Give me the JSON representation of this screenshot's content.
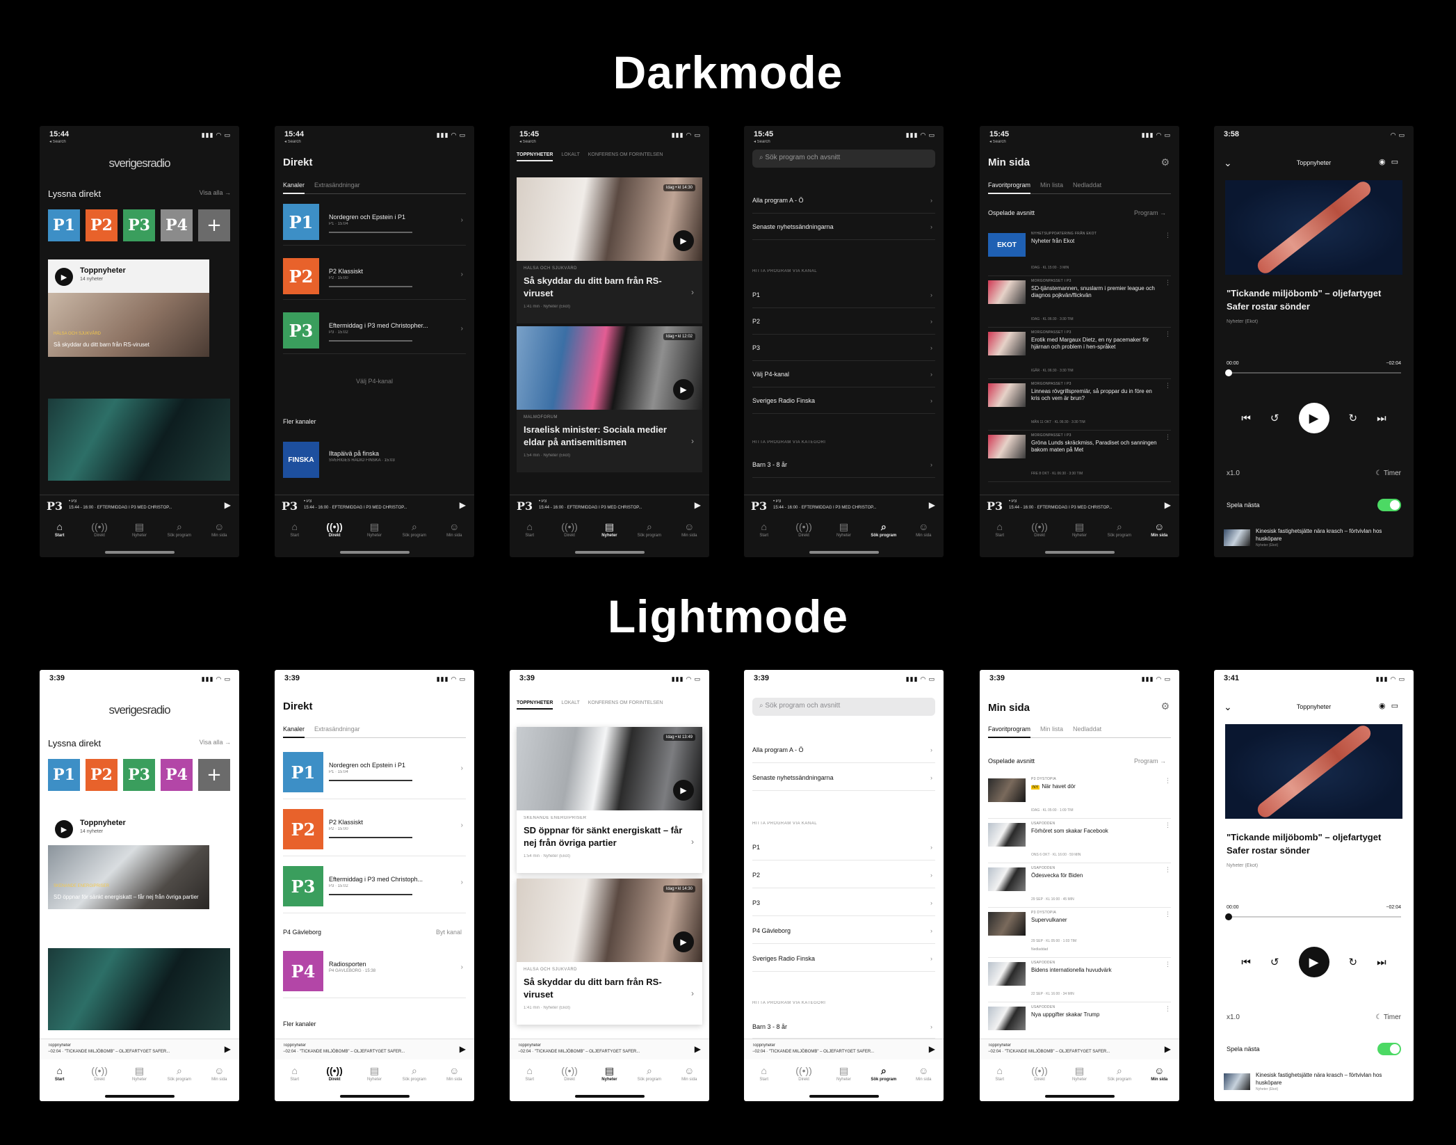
{
  "headings": {
    "dark": "Darkmode",
    "light": "Lightmode"
  },
  "status": {
    "dark_time_1": "15:44",
    "dark_time_2": "15:44",
    "dark_time_3": "15:45",
    "dark_time_4": "15:45",
    "dark_time_5": "15:45",
    "dark_time_6": "3:58",
    "light_time": "3:39",
    "light_time_6": "3:41",
    "back": "◂ Search"
  },
  "home": {
    "logo": "sverigesradio",
    "listen_title": "Lyssna direkt",
    "see_all": "Visa alla →",
    "channels": [
      "P1",
      "P2",
      "P3",
      "P4",
      "+"
    ],
    "card_title": "Toppnyheter",
    "card_sub": "14 nyheter",
    "dark_tag": "HÄLSA OCH SJUKVÅRD",
    "dark_caption": "Så skyddar du ditt barn från RS-viruset",
    "light_tag": "SKENANDE ENERGIPRISER",
    "light_caption": "SD öppnar för sänkt energiskatt – får nej från övriga partier"
  },
  "miniplayer": {
    "logo": "P3",
    "dark_line1": "• P3",
    "dark_line2": "15:44 - 16:00 · EFTERMIDDAG I P3 MED CHRISTOP...",
    "light_line1": "Toppnyheter",
    "light_line2": "−02:04 · \"TICKANDE MILJÖBOMB\" – OLJEFARTYGET SAFER..."
  },
  "tabs": [
    "Start",
    "Direkt",
    "Nyheter",
    "Sök program",
    "Min sida"
  ],
  "tab_icons": [
    "⌂",
    "((•))",
    "▤",
    "⌕",
    "☺"
  ],
  "direkt": {
    "title": "Direkt",
    "seg": [
      "Kanaler",
      "Extrasändningar"
    ],
    "rows": [
      {
        "name": "Nordegren och Epstein i P1",
        "meta": "P1 · 15:04"
      },
      {
        "name": "P2 Klassiskt",
        "meta": "P2 · 15:00"
      },
      {
        "name": "Eftermiddag i P3 med Christopher...",
        "meta": "P3 · 15:02"
      }
    ],
    "light_row3": "Eftermiddag i P3 med Christoph...",
    "choose_p4": "Välj P4-kanal",
    "more_channels": "Fler kanaler",
    "finska_tile": "FINSKA",
    "finska_name": "Iltapäivä på finska",
    "finska_meta": "SVERIGES RADIO FINSKA · 15:03",
    "p4_region": "P4 Gävleborg",
    "change_channel": "Byt kanal",
    "radiosporten": "Radiosporten",
    "radiosporten_meta": "P4 GÄVLEBORG · 15:38"
  },
  "nyheter": {
    "nav": [
      "TOPPNYHETER",
      "LOKALT",
      "KONFERENS OM FÖRINTELSEN"
    ],
    "badge1": "Idag • kl 14:30",
    "badge2": "Idag • kl 12:02",
    "badge3": "Idag • kl 13:49",
    "rs_tag": "HÄLSA OCH SJUKVÅRD",
    "rs_title": "Så skyddar du ditt barn från RS-viruset",
    "rs_meta": "1:41 min · Nyheter (Ekot)",
    "isr_tag": "MALMÖFORUM",
    "isr_title": "Israelisk minister: Sociala medier eldar på antisemitismen",
    "isr_meta": "1:54 min · Nyheter (Ekot)",
    "sd_tag": "SKENANDE ENERGIPRISER",
    "sd_title": "SD öppnar för sänkt energiskatt – får nej från övriga partier",
    "sd_meta": "1:54 min · Nyheter (Ekot)"
  },
  "sok": {
    "placeholder": "Sök program och avsnitt",
    "top": [
      "Alla program A - Ö",
      "Senaste nyhetssändningarna"
    ],
    "by_channel": "HITTA PROGRAM VIA KANAL",
    "channels_dark": [
      "P1",
      "P2",
      "P3",
      "Välj P4-kanal",
      "Sveriges Radio Finska"
    ],
    "channels_light": [
      "P1",
      "P2",
      "P3",
      "P4 Gävleborg",
      "Sveriges Radio Finska"
    ],
    "by_category": "HITTA PROGRAM VIA KATEGORI",
    "category_first": "Barn 3 - 8 år"
  },
  "minsida": {
    "title": "Min sida",
    "seg": [
      "Favoritprogram",
      "Min lista",
      "Nedladdat"
    ],
    "unplayed": "Ospelade avsnitt",
    "program_link": "Program →",
    "dark_eps": [
      {
        "tag": "NYHETSUPPDATERING FRÅN EKOT",
        "title": "Nyheter från Ekot",
        "meta": "IDAG · KL 15:00 · 3 MIN",
        "thumb": "EKOT"
      },
      {
        "tag": "MORGONPASSET I P3",
        "title": "SD-tjänstemannen, snuslarm i premier league och diagnos pojkvän/flickvän",
        "meta": "IDAG · KL 06:30 · 3:30 TIM",
        "thumb": ""
      },
      {
        "tag": "MORGONPASSET I P3",
        "title": "Erotik med Margaux Dietz, en ny pacemaker för hjärnan och problem i hen-språket",
        "meta": "IGÅR · KL 06:30 · 3:30 TIM",
        "thumb": ""
      },
      {
        "tag": "MORGONPASSET I P3",
        "title": "Linneas rövgrillspremiär, så proppar du in före en kris och vem är brun?",
        "meta": "MÅN 11 OKT · KL 06:30 · 3:30 TIM",
        "thumb": ""
      },
      {
        "tag": "MORGONPASSET I P3",
        "title": "Gröna Lunds skräckmiss, Paradiset och sanningen bakom maten på Met",
        "meta": "FRE 8 OKT · KL 06:30 · 3:30 TIM",
        "thumb": ""
      }
    ],
    "light_eps": [
      {
        "tag": "P3 DYSTOPIA",
        "title": "När havet dör",
        "meta": "IDAG · KL 05:00 · 1:09 TIM"
      },
      {
        "tag": "USAPODDEN",
        "title": "Förhöret som skakar Facebook",
        "meta": "ONS 6 OKT · KL 16:00 · 59 MIN"
      },
      {
        "tag": "USAPODDEN",
        "title": "Ödesvecka för Biden",
        "meta": "29 SEP · KL 16:00 · 45 MIN"
      },
      {
        "tag": "P3 DYSTOPIA",
        "title": "Supervulkaner",
        "meta": "29 SEP · KL 05:00 · 1:03 TIM"
      },
      {
        "tag": "USAPODDEN",
        "title": "Bidens internationella huvudvärk",
        "meta": "22 SEP · KL 16:00 · 34 MIN"
      },
      {
        "tag": "USAPODDEN",
        "title": "Nya uppgifter skakar Trump",
        "meta": ""
      }
    ],
    "new_badge": "NY",
    "downloaded": "Nedladdad"
  },
  "nowplaying": {
    "header": "Toppnyheter",
    "title": "\"Tickande miljöbomb\" – oljefartyget Safer rostar sönder",
    "sub": "Nyheter (Ekot)",
    "elapsed": "00:00",
    "remaining": "−02:04",
    "play_next": "Spela nästa",
    "queue_title": "Kinesisk fastighetsjätte nära krasch – förtvivlan hos husköpare",
    "queue_sub": "Nyheter (Ekot)",
    "speed": "x1.0",
    "timer": "Timer",
    "progress_fraction": 0
  },
  "colors": {
    "p1": "#3d8fc6",
    "p2": "#e8622b",
    "p3": "#3a9e5d",
    "p4_dark": "#8b8b8b",
    "p4_light": "#b346a7",
    "toggle": "#4cd964"
  }
}
